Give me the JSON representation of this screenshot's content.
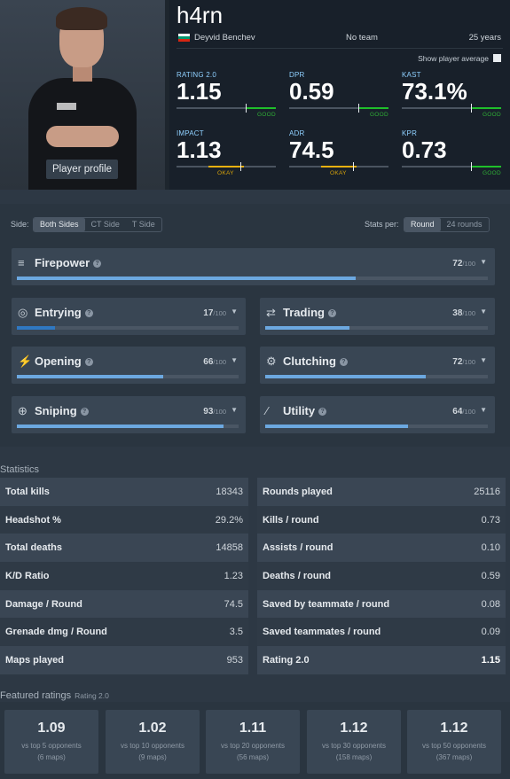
{
  "player": {
    "nickname": "h4rn",
    "real_name": "Deyvid Benchev",
    "team": "No team",
    "age": "25 years",
    "profile_button": "Player profile",
    "show_average_label": "Show player average",
    "flag_colors": [
      "#ffffff",
      "#00966e",
      "#d62612"
    ]
  },
  "summary": [
    {
      "label": "RATING 2.0",
      "value": "1.15",
      "grade": "GOOD",
      "level": "good"
    },
    {
      "label": "DPR",
      "value": "0.59",
      "grade": "GOOD",
      "level": "good"
    },
    {
      "label": "KAST",
      "value": "73.1%",
      "grade": "GOOD",
      "level": "good"
    },
    {
      "label": "IMPACT",
      "value": "1.13",
      "grade": "OKAY",
      "level": "okay"
    },
    {
      "label": "ADR",
      "value": "74.5",
      "grade": "OKAY",
      "level": "okay"
    },
    {
      "label": "KPR",
      "value": "0.73",
      "grade": "GOOD",
      "level": "good"
    }
  ],
  "filters": {
    "side_label": "Side:",
    "sides": [
      "Both Sides",
      "CT Side",
      "T Side"
    ],
    "stats_per_label": "Stats per:",
    "per": [
      "Round",
      "24 rounds"
    ]
  },
  "roles": [
    {
      "name": "Firepower",
      "score": "72",
      "max": "/100",
      "icon": "firepower-icon"
    },
    {
      "name": "Entrying",
      "score": "17",
      "max": "/100",
      "icon": "entrying-icon"
    },
    {
      "name": "Trading",
      "score": "38",
      "max": "/100",
      "icon": "trading-icon"
    },
    {
      "name": "Opening",
      "score": "66",
      "max": "/100",
      "icon": "opening-icon"
    },
    {
      "name": "Clutching",
      "score": "72",
      "max": "/100",
      "icon": "clutching-icon"
    },
    {
      "name": "Sniping",
      "score": "93",
      "max": "/100",
      "icon": "sniping-icon"
    },
    {
      "name": "Utility",
      "score": "64",
      "max": "/100",
      "icon": "utility-icon"
    }
  ],
  "statistics": {
    "title": "Statistics",
    "left": [
      {
        "k": "Total kills",
        "v": "18343"
      },
      {
        "k": "Headshot %",
        "v": "29.2%"
      },
      {
        "k": "Total deaths",
        "v": "14858"
      },
      {
        "k": "K/D Ratio",
        "v": "1.23"
      },
      {
        "k": "Damage / Round",
        "v": "74.5"
      },
      {
        "k": "Grenade dmg / Round",
        "v": "3.5"
      },
      {
        "k": "Maps played",
        "v": "953"
      }
    ],
    "right": [
      {
        "k": "Rounds played",
        "v": "25116"
      },
      {
        "k": "Kills / round",
        "v": "0.73"
      },
      {
        "k": "Assists / round",
        "v": "0.10"
      },
      {
        "k": "Deaths / round",
        "v": "0.59"
      },
      {
        "k": "Saved by teammate / round",
        "v": "0.08"
      },
      {
        "k": "Saved teammates / round",
        "v": "0.09"
      },
      {
        "k": "Rating 2.0",
        "v": "1.15"
      }
    ]
  },
  "featured": {
    "title": "Featured ratings",
    "subtitle": "Rating 2.0",
    "items": [
      {
        "value": "1.09",
        "desc": "vs top 5 opponents",
        "maps": "(6 maps)"
      },
      {
        "value": "1.02",
        "desc": "vs top 10 opponents",
        "maps": "(9 maps)"
      },
      {
        "value": "1.11",
        "desc": "vs top 20 opponents",
        "maps": "(56 maps)"
      },
      {
        "value": "1.12",
        "desc": "vs top 30 opponents",
        "maps": "(158 maps)"
      },
      {
        "value": "1.12",
        "desc": "vs top 50 opponents",
        "maps": "(367 maps)"
      }
    ]
  }
}
